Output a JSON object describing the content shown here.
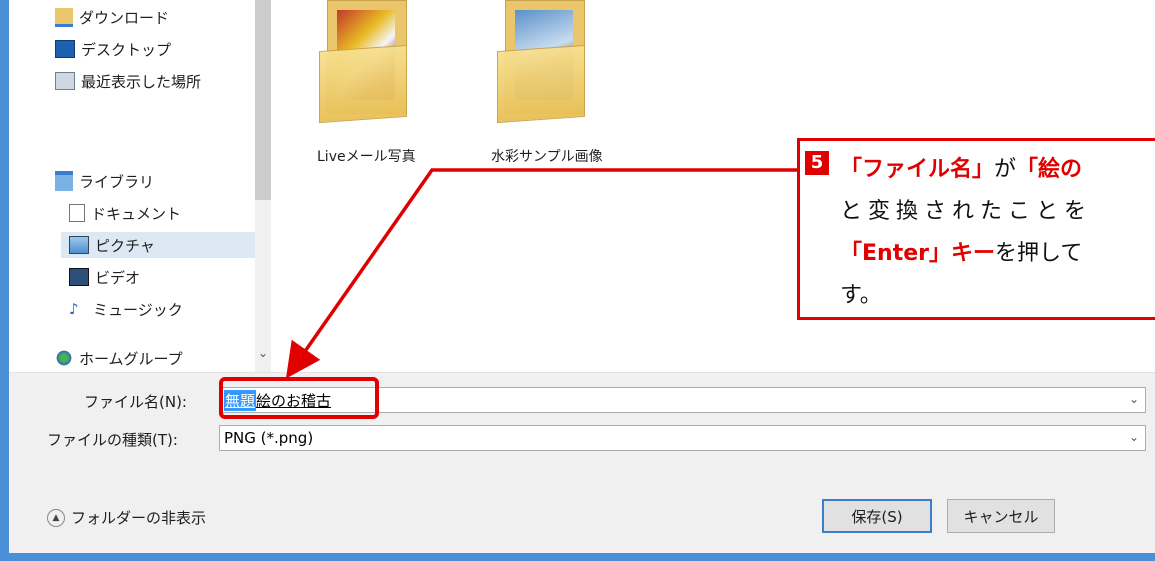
{
  "nav": {
    "items": [
      {
        "label": "ダウンロード",
        "icon": "download-folder-icon"
      },
      {
        "label": "デスクトップ",
        "icon": "desktop-icon"
      },
      {
        "label": "最近表示した場所",
        "icon": "recent-places-icon"
      },
      {
        "label": "ライブラリ",
        "icon": "library-icon"
      },
      {
        "label": "ドキュメント",
        "icon": "document-icon"
      },
      {
        "label": "ピクチャ",
        "icon": "picture-icon",
        "selected": true
      },
      {
        "label": "ビデオ",
        "icon": "video-icon"
      },
      {
        "label": "ミュージック",
        "icon": "music-icon"
      },
      {
        "label": "ホームグループ",
        "icon": "homegroup-icon"
      }
    ]
  },
  "folders": [
    {
      "label": "Liveメール写真"
    },
    {
      "label": "水彩サンプル画像"
    }
  ],
  "form": {
    "filename_label": "ファイル名(N):",
    "filename_selected": "無題",
    "filename_converted": "絵の",
    "filename_rest": "お稽古",
    "filetype_label": "ファイルの種類(T):",
    "filetype_value": "PNG (*.png)"
  },
  "buttons": {
    "save": "保存(S)",
    "cancel": "キャンセル",
    "hide_folders": "フォルダーの非表示"
  },
  "callout": {
    "number": "5",
    "line1_a": "「ファイル名」",
    "line1_b": "が",
    "line1_c": "「絵の",
    "line2": "と変換されたことを",
    "line3_a": "「Enter」キー",
    "line3_b": "を押して",
    "line4": "す。"
  },
  "colors": {
    "accent_red": "#e00000",
    "selection_blue": "#3399ff",
    "window_border": "#4a8fd8"
  }
}
